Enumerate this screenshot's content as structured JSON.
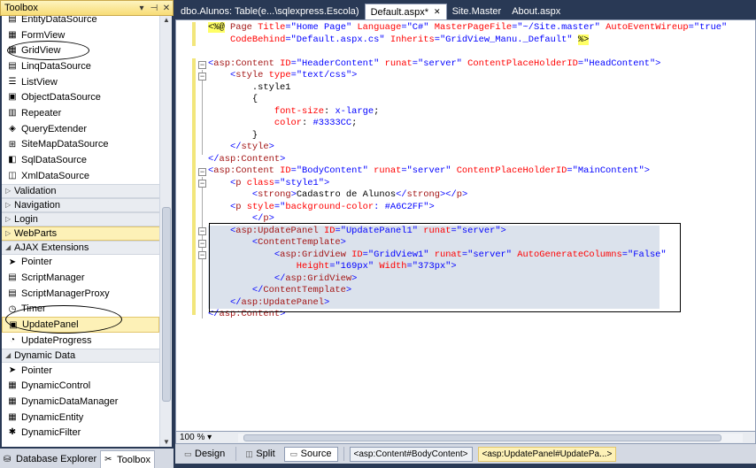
{
  "toolbox": {
    "title": "Toolbox",
    "buttons": [
      "▾",
      "⊣",
      "✕"
    ],
    "items_top": [
      {
        "label": "EntityDataSource",
        "icon": "entity-datasource-icon"
      },
      {
        "label": "FormView",
        "icon": "formview-icon"
      },
      {
        "label": "GridView",
        "icon": "gridview-icon"
      },
      {
        "label": "LinqDataSource",
        "icon": "linq-datasource-icon"
      },
      {
        "label": "ListView",
        "icon": "listview-icon"
      },
      {
        "label": "ObjectDataSource",
        "icon": "object-datasource-icon"
      },
      {
        "label": "Repeater",
        "icon": "repeater-icon"
      },
      {
        "label": "QueryExtender",
        "icon": "query-extender-icon"
      },
      {
        "label": "SiteMapDataSource",
        "icon": "sitemap-datasource-icon"
      },
      {
        "label": "SqlDataSource",
        "icon": "sql-datasource-icon"
      },
      {
        "label": "XmlDataSource",
        "icon": "xml-datasource-icon"
      }
    ],
    "categories_collapsed": [
      "Validation",
      "Navigation",
      "Login",
      "WebParts"
    ],
    "ajax_category": "AJAX Extensions",
    "ajax_items": [
      {
        "label": "Pointer",
        "icon": "pointer-icon"
      },
      {
        "label": "ScriptManager",
        "icon": "script-manager-icon"
      },
      {
        "label": "ScriptManagerProxy",
        "icon": "script-manager-proxy-icon"
      },
      {
        "label": "Timer",
        "icon": "timer-icon"
      },
      {
        "label": "UpdatePanel",
        "icon": "update-panel-icon"
      },
      {
        "label": "UpdateProgress",
        "icon": "update-progress-icon"
      }
    ],
    "dynamic_category": "Dynamic Data",
    "dynamic_items": [
      {
        "label": "Pointer",
        "icon": "pointer-icon"
      },
      {
        "label": "DynamicControl",
        "icon": "dynamic-control-icon"
      },
      {
        "label": "DynamicDataManager",
        "icon": "dynamic-data-manager-icon"
      },
      {
        "label": "DynamicEntity",
        "icon": "dynamic-entity-icon"
      },
      {
        "label": "DynamicFilter",
        "icon": "dynamic-filter-icon"
      }
    ],
    "bottom_tabs": [
      "Database Explorer",
      "Toolbox"
    ]
  },
  "doc_tabs": [
    {
      "label": "dbo.Alunos: Table(e...\\sqlexpress.Escola)",
      "active": false
    },
    {
      "label": "Default.aspx*",
      "active": true
    },
    {
      "label": "Site.Master",
      "active": false
    },
    {
      "label": "About.aspx",
      "active": false
    }
  ],
  "editor": {
    "zoom": "100 %",
    "view_buttons": [
      "Design",
      "Split",
      "Source"
    ],
    "active_view": "Source",
    "breadcrumbs": [
      "<asp:Content#BodyContent>",
      "<asp:UpdatePanel#UpdatePa...>"
    ]
  },
  "code_lines": [
    [
      [
        "t-dir",
        "<%@"
      ],
      [
        "t-black",
        " "
      ],
      [
        "t-mar",
        "Page"
      ],
      [
        "t-black",
        " "
      ],
      [
        "t-red",
        "Title"
      ],
      [
        "t-blue",
        "=\"Home Page\""
      ],
      [
        "t-black",
        " "
      ],
      [
        "t-red",
        "Language"
      ],
      [
        "t-blue",
        "=\"C#\""
      ],
      [
        "t-black",
        " "
      ],
      [
        "t-red",
        "MasterPageFile"
      ],
      [
        "t-blue",
        "=\"~/Site.master\""
      ],
      [
        "t-black",
        " "
      ],
      [
        "t-red",
        "AutoEventWireup"
      ],
      [
        "t-blue",
        "=\"true\""
      ]
    ],
    [
      [
        "t-black",
        "    "
      ],
      [
        "t-red",
        "CodeBehind"
      ],
      [
        "t-blue",
        "=\"Default.aspx.cs\""
      ],
      [
        "t-black",
        " "
      ],
      [
        "t-red",
        "Inherits"
      ],
      [
        "t-blue",
        "=\"GridView_Manu._Default\""
      ],
      [
        "t-black",
        " "
      ],
      [
        "t-dir",
        "%>"
      ]
    ],
    [
      [
        "t-black",
        ""
      ]
    ],
    [
      [
        "t-blue",
        "<"
      ],
      [
        "t-mar",
        "asp:Content"
      ],
      [
        "t-black",
        " "
      ],
      [
        "t-red",
        "ID"
      ],
      [
        "t-blue",
        "=\"HeaderContent\""
      ],
      [
        "t-black",
        " "
      ],
      [
        "t-red",
        "runat"
      ],
      [
        "t-blue",
        "=\"server\""
      ],
      [
        "t-black",
        " "
      ],
      [
        "t-red",
        "ContentPlaceHolderID"
      ],
      [
        "t-blue",
        "=\"HeadContent\">"
      ]
    ],
    [
      [
        "t-black",
        "    "
      ],
      [
        "t-blue",
        "<"
      ],
      [
        "t-mar",
        "style"
      ],
      [
        "t-black",
        " "
      ],
      [
        "t-red",
        "type"
      ],
      [
        "t-blue",
        "=\"text/css\">"
      ]
    ],
    [
      [
        "t-black",
        "        .style1"
      ]
    ],
    [
      [
        "t-black",
        "        {"
      ]
    ],
    [
      [
        "t-black",
        "            "
      ],
      [
        "t-red",
        "font-size"
      ],
      [
        "t-black",
        ": "
      ],
      [
        "t-blue",
        "x-large"
      ],
      [
        "t-black",
        ";"
      ]
    ],
    [
      [
        "t-black",
        "            "
      ],
      [
        "t-red",
        "color"
      ],
      [
        "t-black",
        ": "
      ],
      [
        "t-blue",
        "#3333CC"
      ],
      [
        "t-black",
        ";"
      ]
    ],
    [
      [
        "t-black",
        "        }"
      ]
    ],
    [
      [
        "t-black",
        "    "
      ],
      [
        "t-blue",
        "</"
      ],
      [
        "t-mar",
        "style"
      ],
      [
        "t-blue",
        ">"
      ]
    ],
    [
      [
        "t-blue",
        "</"
      ],
      [
        "t-mar",
        "asp:Content"
      ],
      [
        "t-blue",
        ">"
      ]
    ],
    [
      [
        "t-blue",
        "<"
      ],
      [
        "t-mar",
        "asp:Content"
      ],
      [
        "t-black",
        " "
      ],
      [
        "t-red",
        "ID"
      ],
      [
        "t-blue",
        "=\"BodyContent\""
      ],
      [
        "t-black",
        " "
      ],
      [
        "t-red",
        "runat"
      ],
      [
        "t-blue",
        "=\"server\""
      ],
      [
        "t-black",
        " "
      ],
      [
        "t-red",
        "ContentPlaceHolderID"
      ],
      [
        "t-blue",
        "=\"MainContent\">"
      ]
    ],
    [
      [
        "t-black",
        "    "
      ],
      [
        "t-blue",
        "<"
      ],
      [
        "t-mar",
        "p"
      ],
      [
        "t-black",
        " "
      ],
      [
        "t-red",
        "class"
      ],
      [
        "t-blue",
        "=\"style1\">"
      ]
    ],
    [
      [
        "t-black",
        "        "
      ],
      [
        "t-blue",
        "<"
      ],
      [
        "t-mar",
        "strong"
      ],
      [
        "t-blue",
        ">"
      ],
      [
        "t-black",
        "Cadastro de Alunos"
      ],
      [
        "t-blue",
        "</"
      ],
      [
        "t-mar",
        "strong"
      ],
      [
        "t-blue",
        "></"
      ],
      [
        "t-mar",
        "p"
      ],
      [
        "t-blue",
        ">"
      ]
    ],
    [
      [
        "t-black",
        "    "
      ],
      [
        "t-blue",
        "<"
      ],
      [
        "t-mar",
        "p"
      ],
      [
        "t-black",
        " "
      ],
      [
        "t-red",
        "style"
      ],
      [
        "t-blue",
        "=\""
      ],
      [
        "t-red",
        "background-color"
      ],
      [
        "t-blue",
        ": #A6C2FF\">"
      ]
    ],
    [
      [
        "t-black",
        "        "
      ],
      [
        "t-blue",
        "</"
      ],
      [
        "t-mar",
        "p"
      ],
      [
        "t-blue",
        ">"
      ]
    ],
    [
      [
        "t-black",
        "    "
      ],
      [
        "t-blue",
        "<"
      ],
      [
        "t-mar",
        "asp:UpdatePanel"
      ],
      [
        "t-black",
        " "
      ],
      [
        "t-red",
        "ID"
      ],
      [
        "t-blue",
        "=\"UpdatePanel1\""
      ],
      [
        "t-black",
        " "
      ],
      [
        "t-red",
        "runat"
      ],
      [
        "t-blue",
        "=\"server\">"
      ]
    ],
    [
      [
        "t-black",
        "        "
      ],
      [
        "t-blue",
        "<"
      ],
      [
        "t-mar",
        "ContentTemplate"
      ],
      [
        "t-blue",
        ">"
      ]
    ],
    [
      [
        "t-black",
        "            "
      ],
      [
        "t-blue",
        "<"
      ],
      [
        "t-mar",
        "asp:GridView"
      ],
      [
        "t-black",
        " "
      ],
      [
        "t-red",
        "ID"
      ],
      [
        "t-blue",
        "=\"GridView1\""
      ],
      [
        "t-black",
        " "
      ],
      [
        "t-red",
        "runat"
      ],
      [
        "t-blue",
        "=\"server\""
      ],
      [
        "t-black",
        " "
      ],
      [
        "t-red",
        "AutoGenerateColumns"
      ],
      [
        "t-blue",
        "=\"False\""
      ]
    ],
    [
      [
        "t-black",
        "                "
      ],
      [
        "t-red",
        "Height"
      ],
      [
        "t-blue",
        "=\"169px\""
      ],
      [
        "t-black",
        " "
      ],
      [
        "t-red",
        "Width"
      ],
      [
        "t-blue",
        "=\"373px\">"
      ]
    ],
    [
      [
        "t-black",
        "            "
      ],
      [
        "t-blue",
        "</"
      ],
      [
        "t-mar",
        "asp:GridView"
      ],
      [
        "t-blue",
        ">"
      ]
    ],
    [
      [
        "t-black",
        "        "
      ],
      [
        "t-blue",
        "</"
      ],
      [
        "t-mar",
        "ContentTemplate"
      ],
      [
        "t-blue",
        ">"
      ]
    ],
    [
      [
        "t-black",
        "    "
      ],
      [
        "t-blue",
        "</"
      ],
      [
        "t-mar",
        "asp:UpdatePanel"
      ],
      [
        "t-blue",
        ">"
      ]
    ],
    [
      [
        "t-blue",
        "</"
      ],
      [
        "t-mar",
        "asp:Content"
      ],
      [
        "t-blue",
        ">"
      ]
    ]
  ]
}
